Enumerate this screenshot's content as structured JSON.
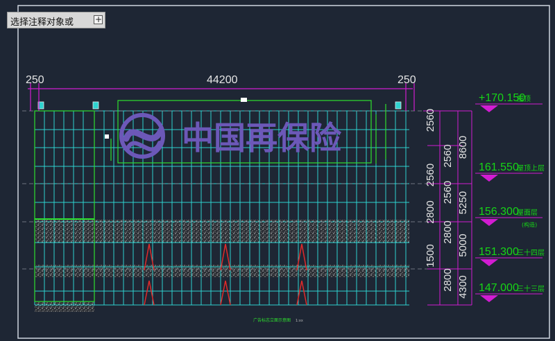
{
  "prompt": {
    "text": "选择注释对象或",
    "expand_icon": "plus-icon"
  },
  "watermark": {
    "text": "中国再保险",
    "logo": "china-re-logo"
  },
  "dimensions_top": {
    "left": "250",
    "middle": "44200",
    "right": "250"
  },
  "right_dims": {
    "col1": [
      "2560",
      "2560",
      "2560",
      "2560",
      "2800",
      "2800",
      "1500",
      "2800"
    ],
    "col2": [
      "8600",
      "5250",
      "5000",
      "4300"
    ]
  },
  "levels": [
    {
      "elev": "+170.150",
      "name": "屋顶"
    },
    {
      "elev": "161.550",
      "name": "屋顶上层"
    },
    {
      "elev": "156.300",
      "name": "屋面层"
    },
    {
      "elev": "151.300",
      "name": "三十四层"
    },
    {
      "elev": "147.000",
      "name": "三十三层"
    }
  ],
  "level_note": "(构造)",
  "bottom_caption": "广告标志立面示意图",
  "caption_scale": "1:xx",
  "colors": {
    "background": "#1e2634",
    "grid": "#2fd3d0",
    "dimension": "#d21cd2",
    "level_text": "#16d616",
    "logo": "#6c58b8",
    "hatch": "#b8b8b8"
  }
}
